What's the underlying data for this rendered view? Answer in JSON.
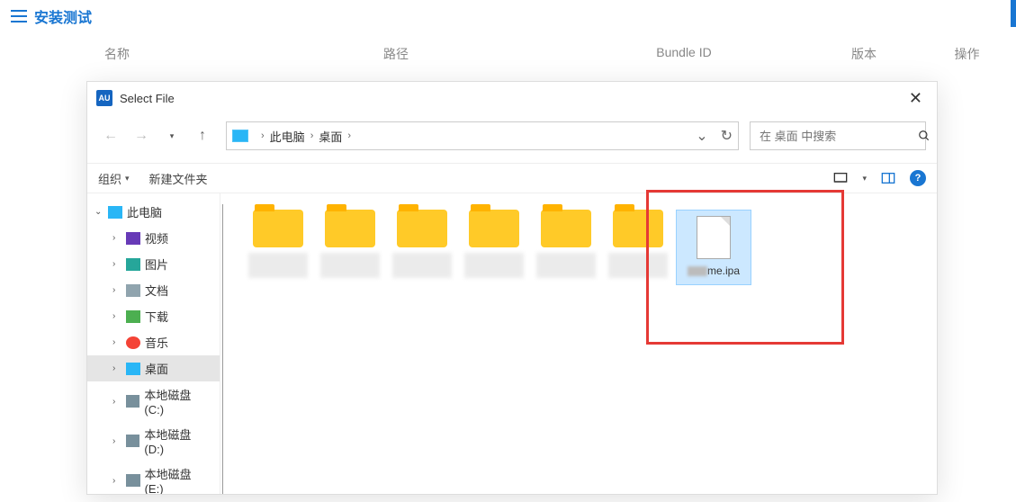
{
  "app": {
    "title": "安装测试"
  },
  "columns": {
    "name": "名称",
    "path": "路径",
    "bundle": "Bundle ID",
    "version": "版本",
    "op": "操作"
  },
  "dialog": {
    "badge": "AU",
    "title": "Select File",
    "crumbs": [
      "此电脑",
      "桌面"
    ],
    "search_placeholder": "在 桌面 中搜索",
    "toolbar": {
      "organize": "组织",
      "new_folder": "新建文件夹"
    },
    "tree": {
      "root": "此电脑",
      "items": [
        "视频",
        "图片",
        "文档",
        "下载",
        "音乐",
        "桌面",
        "本地磁盘 (C:)",
        "本地磁盘 (D:)",
        "本地磁盘 (E:)"
      ]
    },
    "ipa_suffix": "me.ipa"
  }
}
